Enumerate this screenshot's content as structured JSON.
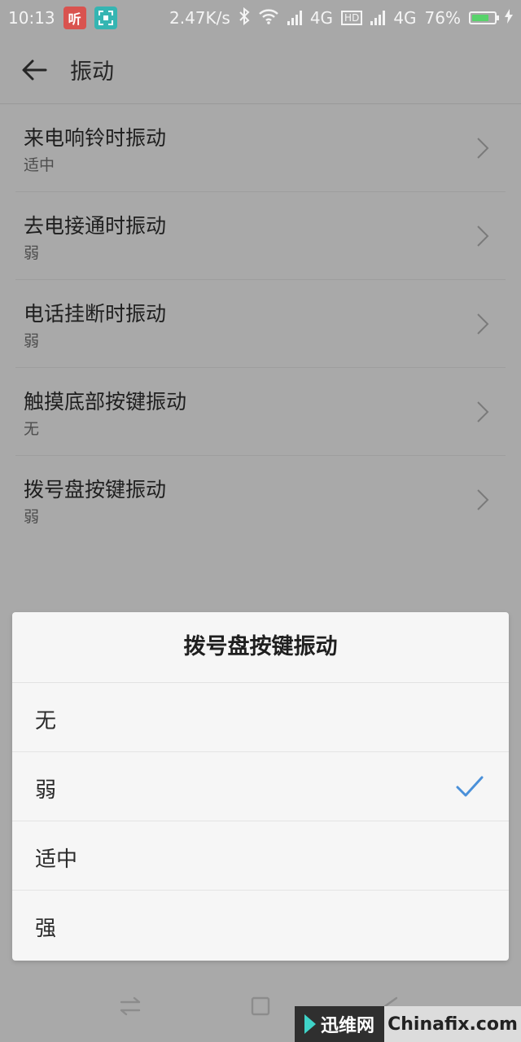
{
  "status_bar": {
    "time": "10:13",
    "badge_1": "听",
    "speed": "2.47K/s",
    "net_1": "4G",
    "hd": "HD",
    "net_2": "4G",
    "battery_percent": "76%",
    "battery_level": 0.76
  },
  "header": {
    "title": "振动"
  },
  "settings": [
    {
      "title": "来电响铃时振动",
      "value": "适中"
    },
    {
      "title": "去电接通时振动",
      "value": "弱"
    },
    {
      "title": "电话挂断时振动",
      "value": "弱"
    },
    {
      "title": "触摸底部按键振动",
      "value": "无"
    },
    {
      "title": "拨号盘按键振动",
      "value": "弱"
    }
  ],
  "dialog": {
    "title": "拨号盘按键振动",
    "options": [
      {
        "label": "无",
        "selected": false
      },
      {
        "label": "弱",
        "selected": true
      },
      {
        "label": "适中",
        "selected": false
      },
      {
        "label": "强",
        "selected": false
      }
    ],
    "accent_color": "#4a90d9"
  },
  "watermark": {
    "left_text": "迅维网",
    "right_text": "Chinafix.com"
  }
}
